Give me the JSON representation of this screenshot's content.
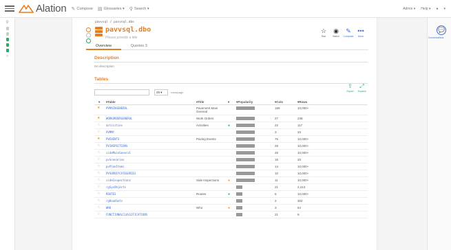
{
  "topbar": {
    "logo": "Alation",
    "nav": [
      {
        "icon": "pencil-icon",
        "label": "Compose"
      },
      {
        "icon": "book-icon",
        "label": "Glossaries ▾"
      },
      {
        "icon": "search-icon",
        "label": "Search ▾"
      }
    ],
    "right": [
      "Admin ▾",
      "Help ▾",
      "▾"
    ]
  },
  "breadcrumb": "pavvsql / pavvsql.dbo",
  "page": {
    "title": "pavvsql.dbo",
    "subtitle": "Please provide a title",
    "actions": [
      {
        "icon": "star-icon",
        "label": "Star"
      },
      {
        "icon": "eye-icon",
        "label": "Watch"
      },
      {
        "icon": "pen-icon",
        "label": "Compose"
      },
      {
        "icon": "more-icon",
        "label": "More"
      }
    ],
    "tabs": [
      {
        "label": "Overview",
        "active": true
      },
      {
        "label": "Queries 3",
        "active": false
      }
    ]
  },
  "description": {
    "heading": "Description",
    "text": "No description"
  },
  "tables": {
    "heading": "Tables",
    "page_size": "25",
    "rows_label": "rows/page",
    "buttons": [
      {
        "icon": "export-icon",
        "label": "Export"
      },
      {
        "icon": "expand-icon",
        "label": "Expand"
      }
    ],
    "headers": {
      "table": "Table",
      "title": "Title",
      "popularity": "Popularity",
      "cols": "Cols",
      "rows": "Rows"
    },
    "rows": [
      {
        "star": true,
        "name": "PVMAINGENERAL",
        "title": "Pavement Main General",
        "dot": "",
        "pop": 0.9,
        "cols": "199",
        "rows": "10,000+"
      },
      {
        "star": true,
        "name": "WORKORDERGENERAL",
        "title": "Work Orders",
        "dot": "",
        "pop": 0.9,
        "cols": "27",
        "rows": "238"
      },
      {
        "star": false,
        "name": "activities",
        "title": "Activities",
        "dot": "#27ae60",
        "pop": 0.9,
        "cols": "22",
        "rows": "117"
      },
      {
        "star": false,
        "name": "PVMMY",
        "title": "",
        "dot": "",
        "pop": 0.9,
        "cols": "3",
        "rows": "33"
      },
      {
        "star": true,
        "name": "PVEVENTS",
        "title": "Paving Events",
        "dot": "",
        "pop": 0.9,
        "cols": "76",
        "rows": "10,000+"
      },
      {
        "star": false,
        "name": "PVINSPECTIONS",
        "title": "",
        "dot": "",
        "pop": 0.9,
        "cols": "29",
        "rows": "10,000+"
      },
      {
        "star": false,
        "name": "sideMainGeneral",
        "title": "",
        "dot": "",
        "pop": 0.9,
        "cols": "48",
        "rows": "10,000+"
      },
      {
        "star": false,
        "name": "pvScenarios",
        "title": "",
        "dot": "",
        "pop": 0.9,
        "cols": "16",
        "rows": "20"
      },
      {
        "star": false,
        "name": "pvPlanItems",
        "title": "",
        "dot": "",
        "pop": 0.9,
        "cols": "14",
        "rows": "10,000+"
      },
      {
        "star": false,
        "name": "PVSURVEYCATEGORIES",
        "title": "",
        "dot": "",
        "pop": 0.9,
        "cols": "10",
        "rows": "10,000+"
      },
      {
        "star": false,
        "name": "sideInspections",
        "title": "Side Inspections",
        "dot": "#f39c12",
        "pop": 0.9,
        "cols": "11",
        "rows": "10,000+"
      },
      {
        "star": false,
        "name": "rgSysObjects",
        "title": "",
        "dot": "",
        "pop": 0.3,
        "cols": "21",
        "rows": "2,413"
      },
      {
        "star": false,
        "name": "ROUTES",
        "title": "Routes",
        "dot": "#27ae60",
        "pop": 0.3,
        "cols": "6",
        "rows": "10,000+"
      },
      {
        "star": false,
        "name": "rgRoadSets",
        "title": "",
        "dot": "",
        "pop": 0.3,
        "cols": "2",
        "rows": "302"
      },
      {
        "star": false,
        "name": "WHO",
        "title": "Who",
        "dot": "#f39c12",
        "pop": 0.3,
        "cols": "3",
        "rows": "54"
      },
      {
        "star": false,
        "name": "FUNCTIONALCLASSIFICATIONS",
        "title": "",
        "dot": "",
        "pop": 0.3,
        "cols": "21",
        "rows": "9"
      }
    ]
  },
  "right_panel": {
    "label": "Conversations"
  },
  "colors": {
    "accent": "#e67e22",
    "link": "#3a6fd8",
    "green": "#27ae60"
  }
}
